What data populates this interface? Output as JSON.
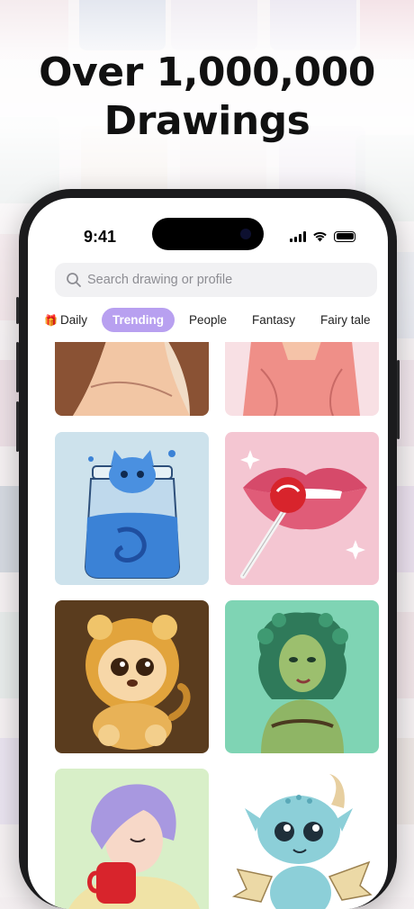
{
  "headline": {
    "line1": "Over 1,000,000",
    "line2": "Drawings"
  },
  "status_bar": {
    "time": "9:41"
  },
  "search": {
    "placeholder": "Search drawing or profile"
  },
  "tabs": [
    {
      "label": "Daily",
      "icon": "gift-icon",
      "active": false
    },
    {
      "label": "Trending",
      "active": true
    },
    {
      "label": "People",
      "active": false
    },
    {
      "label": "Fantasy",
      "active": false
    },
    {
      "label": "Fairy tale",
      "active": false
    }
  ],
  "colors": {
    "accent": "#b8a0f0",
    "phone_frame": "#1b1b1d"
  },
  "cards": [
    {
      "name": "woman-long-hair"
    },
    {
      "name": "woman-pink-top"
    },
    {
      "name": "cat-in-jar"
    },
    {
      "name": "lips-lollipop"
    },
    {
      "name": "lion-cub"
    },
    {
      "name": "medusa"
    },
    {
      "name": "girl-with-mug"
    },
    {
      "name": "baby-dragon"
    }
  ]
}
